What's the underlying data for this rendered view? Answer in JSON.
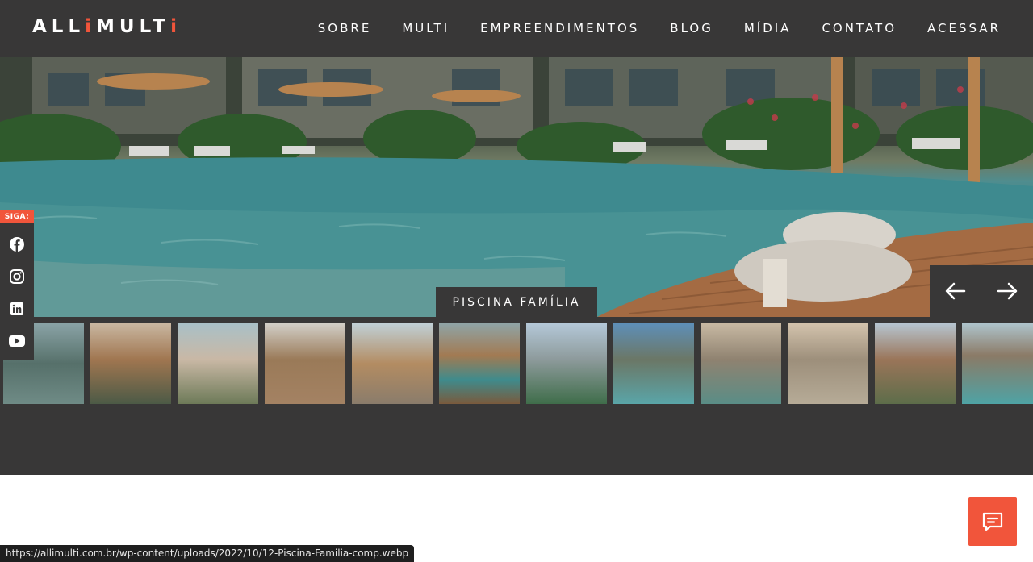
{
  "header": {
    "logo": {
      "part1": "ALLi",
      "part2": "MULTi"
    },
    "nav": [
      "SOBRE",
      "MULTI",
      "EMPREENDIMENTOS",
      "BLOG",
      "MÍDIA",
      "CONTATO",
      "ACESSAR"
    ]
  },
  "gallery": {
    "caption": "PISCINA FAMÍLIA",
    "prev_icon": "arrow-left-icon",
    "next_icon": "arrow-right-icon",
    "thumbnail_count": 12
  },
  "social": {
    "label": "SIGA:",
    "icons": [
      "facebook-icon",
      "instagram-icon",
      "linkedin-icon",
      "youtube-icon"
    ]
  },
  "chat": {
    "icon": "chat-icon"
  },
  "status_bar": {
    "url": "https://allimulti.com.br/wp-content/uploads/2022/10/12-Piscina-Familia-comp.webp"
  },
  "colors": {
    "accent": "#f1553b",
    "dark": "#383737"
  }
}
